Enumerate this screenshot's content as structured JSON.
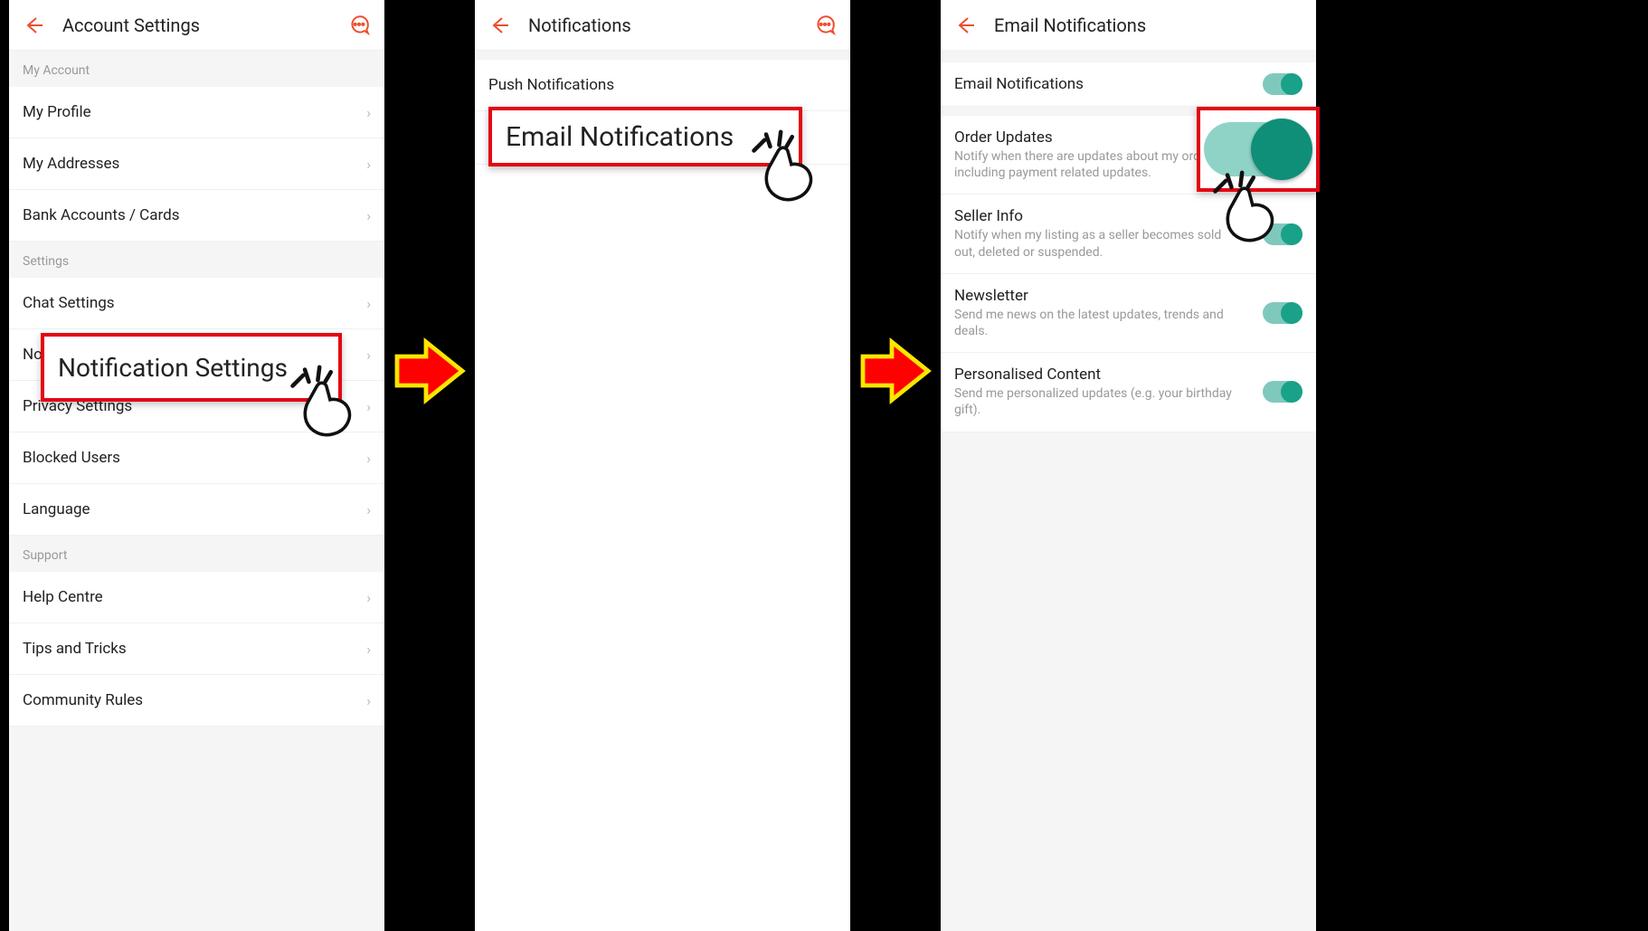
{
  "screen1": {
    "title": "Account Settings",
    "sections": {
      "account": {
        "label": "My Account",
        "items": [
          "My Profile",
          "My Addresses",
          "Bank Accounts / Cards"
        ]
      },
      "settings": {
        "label": "Settings",
        "items": [
          "Chat Settings",
          "Notification Settings",
          "Privacy Settings",
          "Blocked Users",
          "Language"
        ]
      },
      "support": {
        "label": "Support",
        "items": [
          "Help Centre",
          "Tips and Tricks",
          "Community Rules"
        ]
      }
    },
    "highlight_label": "Notification Settings"
  },
  "screen2": {
    "title": "Notifications",
    "items": [
      "Push Notifications",
      "Email Notifications"
    ],
    "highlight_label": "Email Notifications"
  },
  "screen3": {
    "title": "Email Notifications",
    "items": [
      {
        "title": "Email Notifications",
        "sub": ""
      },
      {
        "title": "Order Updates",
        "sub": "Notify when there are updates about my orders, including payment related updates."
      },
      {
        "title": "Seller Info",
        "sub": "Notify when my listing as a seller becomes sold out, deleted or suspended."
      },
      {
        "title": "Newsletter",
        "sub": "Send me news on the latest updates, trends and deals."
      },
      {
        "title": "Personalised Content",
        "sub": "Send me personalized updates (e.g. your birthday gift)."
      }
    ]
  }
}
